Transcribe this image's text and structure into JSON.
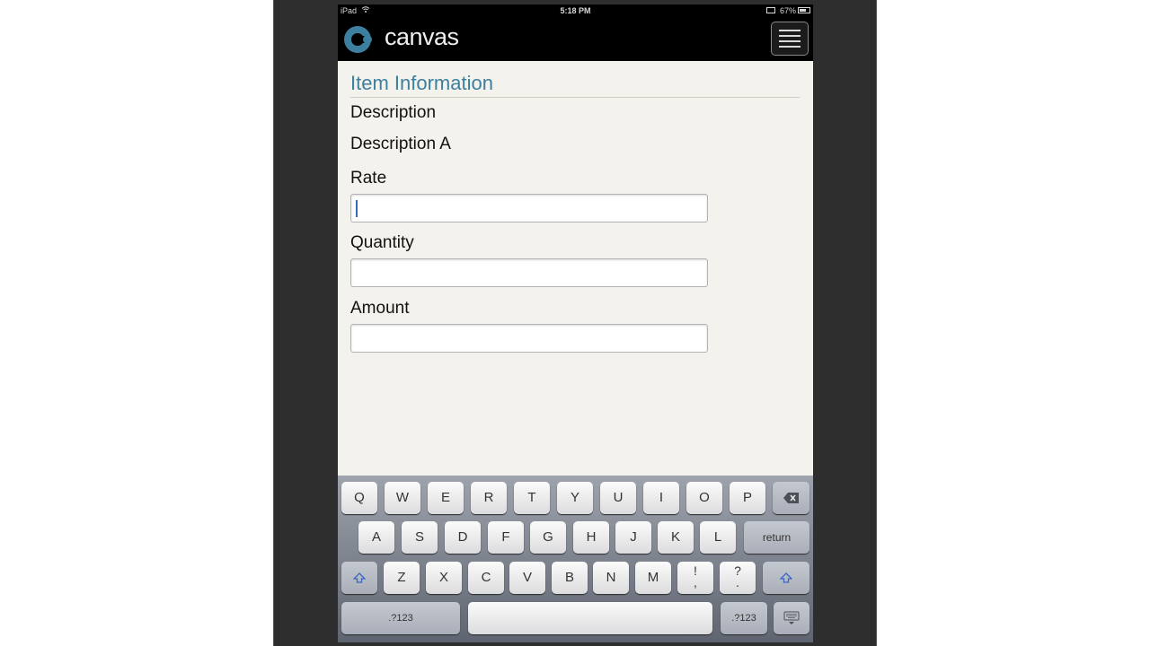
{
  "statusbar": {
    "carrier": "iPad",
    "time": "5:18 PM",
    "battery": "67%",
    "battery_level": 0.67
  },
  "header": {
    "logo_text": "canvas",
    "brand_color": "#3d7f9f"
  },
  "form": {
    "section_title": "Item Information",
    "description_label": "Description",
    "description_value": "Description A",
    "rate_label": "Rate",
    "rate_value": "",
    "quantity_label": "Quantity",
    "quantity_value": "",
    "amount_label": "Amount",
    "amount_value": ""
  },
  "keyboard": {
    "row1": [
      "Q",
      "W",
      "E",
      "R",
      "T",
      "Y",
      "U",
      "I",
      "O",
      "P"
    ],
    "row2": [
      "A",
      "S",
      "D",
      "F",
      "G",
      "H",
      "J",
      "K",
      "L"
    ],
    "row3": [
      "Z",
      "X",
      "C",
      "V",
      "B",
      "N",
      "M"
    ],
    "excl_top": "!",
    "excl_bottom": ",",
    "quest_top": "?",
    "quest_bottom": ".",
    "return_label": "return",
    "numbers_label_left": ".?123",
    "numbers_label_right": ".?123",
    "icons": {
      "backspace": "backspace-icon",
      "shift": "shift-icon",
      "hide": "keyboard-hide-icon"
    }
  }
}
